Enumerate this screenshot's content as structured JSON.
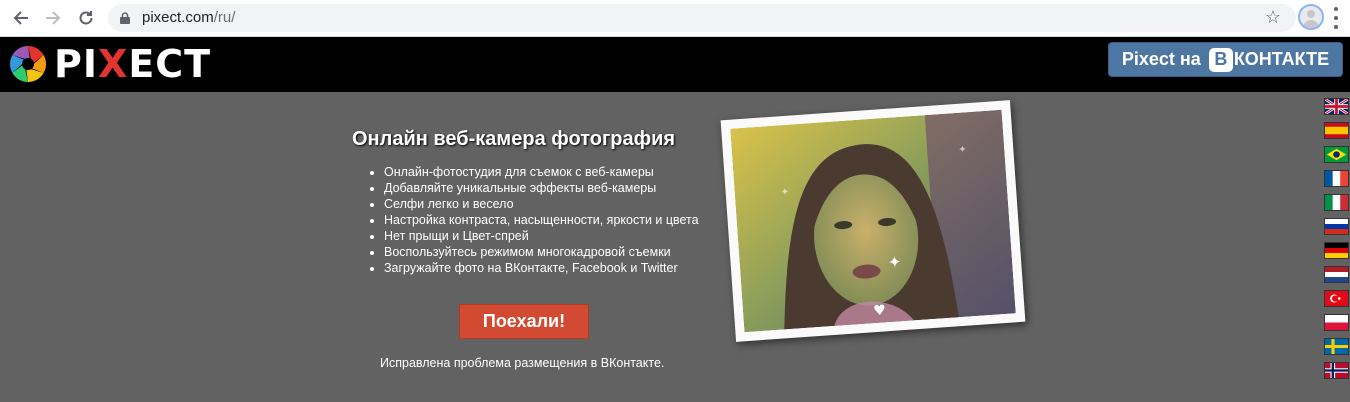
{
  "browser": {
    "url_host": "pixect.com",
    "url_path": "/ru/",
    "icons": {
      "back": "arrow-left-icon",
      "forward": "arrow-right-icon",
      "reload": "reload-icon",
      "lock": "lock-icon",
      "star": "star-icon",
      "profile": "avatar",
      "menu": "kebab-menu-icon"
    }
  },
  "header": {
    "logo_text_left": "PI",
    "logo_text_x": "X",
    "logo_text_right": "ECT",
    "vk_button_prefix": "Pixect на",
    "vk_badge_letter": "В",
    "vk_button_suffix": "КОНТАКТЕ",
    "brand_color": "#4d76a3",
    "logo_accent": "#e3342f"
  },
  "main": {
    "headline": "Онлайн веб-камера фотография",
    "features": [
      "Онлайн-фотостудия для съемок с веб-камеры",
      "Добавляйте уникальные эффекты веб-камеры",
      "Селфи легко и весело",
      "Настройка контраста, насыщенности, яркости и цвета",
      "Нет прыщи и Цвет-спрей",
      "Воспользуйтесь режимом многокадровой съемки",
      "Загружайте фото на ВКонтакте, Facebook и Twitter"
    ],
    "go_button": "Поехали!",
    "go_button_color": "#d14a31",
    "notice": "Исправлена проблема размещения в ВКонтакте."
  },
  "languages": [
    "English",
    "Español",
    "Português",
    "Français",
    "Italiano",
    "Русский",
    "Deutsch",
    "Nederlands",
    "Türkçe",
    "Polski",
    "Svenska",
    "Norsk"
  ]
}
